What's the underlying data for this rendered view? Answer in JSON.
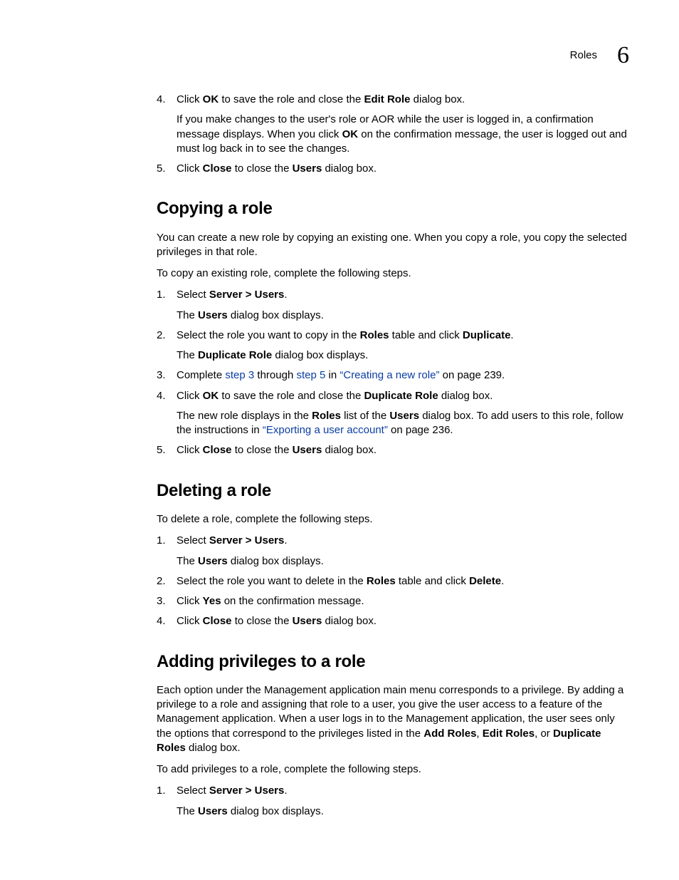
{
  "header": {
    "running_title": "Roles",
    "chapter_number": "6"
  },
  "intro_steps": [
    {
      "num": "4.",
      "parts": [
        "Click ",
        {
          "b": "OK"
        },
        " to save the role and close the ",
        {
          "b": "Edit Role"
        },
        " dialog box."
      ],
      "sub_parts": [
        "If you make changes to the user's role or AOR while the user is logged in, a confirmation message displays. When you click ",
        {
          "b": "OK"
        },
        " on the confirmation message, the user is logged out and must log back in to see the changes."
      ]
    },
    {
      "num": "5.",
      "parts": [
        "Click ",
        {
          "b": "Close"
        },
        " to close the ",
        {
          "b": "Users"
        },
        " dialog box."
      ]
    }
  ],
  "copying": {
    "heading": "Copying a role",
    "p1": "You can create a new role by copying an existing one. When you copy a role, you copy the selected privileges in that role.",
    "p2": "To copy an existing role, complete the following steps.",
    "steps": [
      {
        "num": "1.",
        "parts": [
          "Select ",
          {
            "b": "Server > Users"
          },
          "."
        ],
        "sub_parts": [
          "The ",
          {
            "b": "Users"
          },
          " dialog box displays."
        ]
      },
      {
        "num": "2.",
        "parts": [
          "Select the role you want to copy in the ",
          {
            "b": "Roles"
          },
          " table and click ",
          {
            "b": "Duplicate"
          },
          "."
        ],
        "sub_parts": [
          "The ",
          {
            "b": "Duplicate Role"
          },
          " dialog box displays."
        ]
      },
      {
        "num": "3.",
        "parts": [
          "Complete ",
          {
            "l": "step 3"
          },
          " through ",
          {
            "l": "step 5"
          },
          " in ",
          {
            "lq": "Creating a new role"
          },
          " on page 239."
        ]
      },
      {
        "num": "4.",
        "parts": [
          "Click ",
          {
            "b": "OK"
          },
          " to save the role and close the ",
          {
            "b": "Duplicate Role"
          },
          " dialog box."
        ],
        "sub_parts": [
          "The new role displays in the ",
          {
            "b": "Roles"
          },
          " list of the ",
          {
            "b": "Users"
          },
          " dialog box. To add users to this role, follow the instructions in ",
          {
            "lq": "Exporting a user account"
          },
          " on page 236."
        ]
      },
      {
        "num": "5.",
        "parts": [
          "Click ",
          {
            "b": "Close"
          },
          " to close the ",
          {
            "b": "Users"
          },
          " dialog box."
        ]
      }
    ]
  },
  "deleting": {
    "heading": "Deleting a role",
    "p1": "To delete a role, complete the following steps.",
    "steps": [
      {
        "num": "1.",
        "parts": [
          "Select ",
          {
            "b": "Server > Users"
          },
          "."
        ],
        "sub_parts": [
          "The ",
          {
            "b": "Users"
          },
          " dialog box displays."
        ]
      },
      {
        "num": "2.",
        "parts": [
          "Select the role you want to delete in the ",
          {
            "b": "Roles"
          },
          " table and click ",
          {
            "b": "Delete"
          },
          "."
        ]
      },
      {
        "num": "3.",
        "parts": [
          "Click ",
          {
            "b": "Yes"
          },
          " on the confirmation message."
        ]
      },
      {
        "num": "4.",
        "parts": [
          "Click ",
          {
            "b": "Close"
          },
          " to close the ",
          {
            "b": "Users"
          },
          " dialog box."
        ]
      }
    ]
  },
  "adding": {
    "heading": "Adding privileges to a role",
    "p1_parts": [
      "Each option under the Management application main menu corresponds to a privilege. By adding a privilege to a role and assigning that role to a user, you give the user access to a feature of the Management application. When a user logs in to the Management application, the user sees only the options that correspond to the privileges listed in the ",
      {
        "b": "Add Roles"
      },
      ", ",
      {
        "b": "Edit Roles"
      },
      ", or ",
      {
        "b": "Duplicate Roles"
      },
      " dialog box."
    ],
    "p2": "To add privileges to a role, complete the following steps.",
    "steps": [
      {
        "num": "1.",
        "parts": [
          "Select ",
          {
            "b": "Server > Users"
          },
          "."
        ],
        "sub_parts": [
          "The ",
          {
            "b": "Users"
          },
          " dialog box displays."
        ]
      }
    ]
  }
}
